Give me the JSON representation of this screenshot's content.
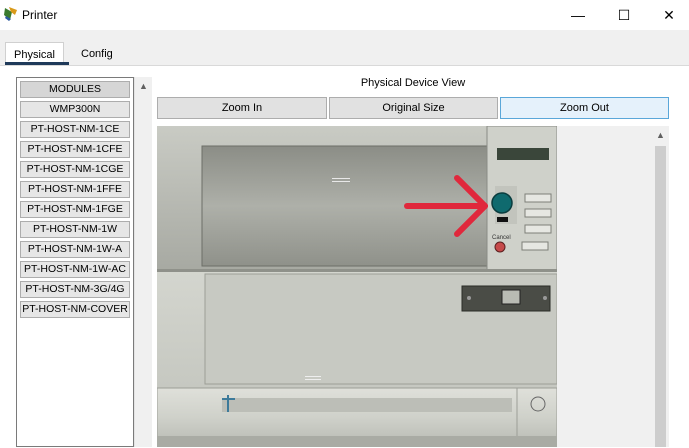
{
  "window": {
    "title": "Printer",
    "minimize_glyph": "—",
    "maximize_glyph": "☐",
    "close_glyph": "✕"
  },
  "tabs": [
    {
      "label": "Physical",
      "active": true
    },
    {
      "label": "Config",
      "active": false
    }
  ],
  "modules": {
    "header": "MODULES",
    "items": [
      "WMP300N",
      "PT-HOST-NM-1CE",
      "PT-HOST-NM-1CFE",
      "PT-HOST-NM-1CGE",
      "PT-HOST-NM-1FFE",
      "PT-HOST-NM-1FGE",
      "PT-HOST-NM-1W",
      "PT-HOST-NM-1W-A",
      "PT-HOST-NM-1W-AC",
      "PT-HOST-NM-3G/4G",
      "PT-HOST-NM-COVER"
    ]
  },
  "physical_view": {
    "title": "Physical Device View",
    "zoom_in": "Zoom In",
    "original_size": "Original Size",
    "zoom_out": "Zoom Out"
  },
  "device": {
    "cancel_label": "Cancel",
    "power_button_color": "#0f6a6e",
    "arrow_color": "#e0283c"
  }
}
